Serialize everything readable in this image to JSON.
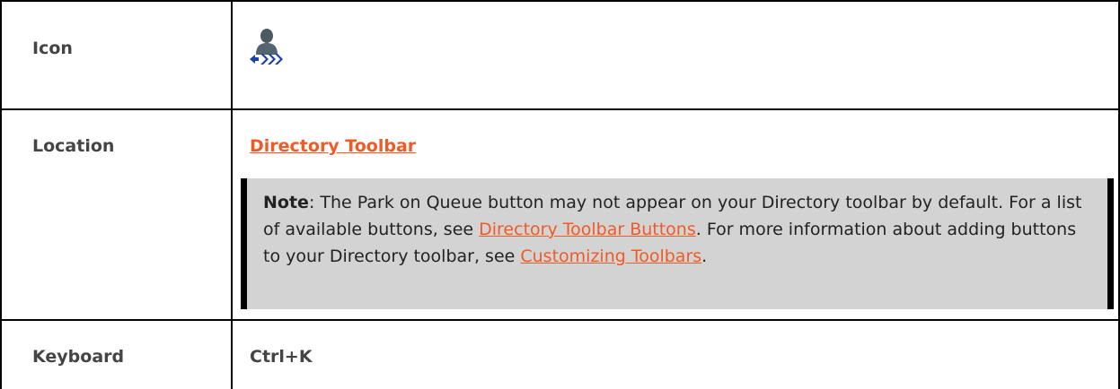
{
  "rows": {
    "icon": {
      "label": "Icon",
      "icon_name": "park-on-queue-icon"
    },
    "location": {
      "label": "Location",
      "link": "Directory Toolbar",
      "note": {
        "prefix": "Note",
        "text1": ": The Park on Queue button may not appear on your Directory toolbar by default. For a list of available buttons, see ",
        "link1": "Directory Toolbar Buttons",
        "text2": ". For more information about adding buttons to your Directory toolbar, see ",
        "link2": "Customizing Toolbars",
        "text3": "."
      }
    },
    "keyboard": {
      "label": "Keyboard",
      "value": "Ctrl+K"
    }
  },
  "colors": {
    "link": "#f15a24",
    "note_background": "#d3d3d3",
    "border": "#000000",
    "label_text": "#444444"
  }
}
